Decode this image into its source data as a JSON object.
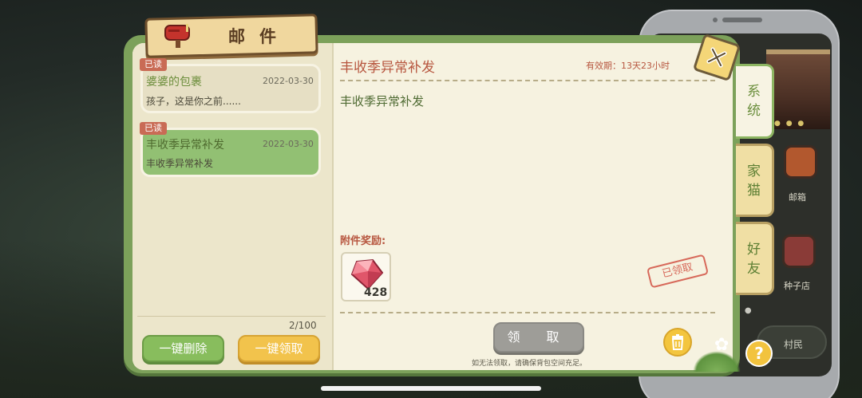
{
  "window": {
    "title": "邮件"
  },
  "mail_list": [
    {
      "badge": "已读",
      "title": "婆婆的包裹",
      "date": "2022-03-30",
      "preview": "孩子，这是你之前......",
      "state": "read"
    },
    {
      "badge": "已读",
      "title": "丰收季异常补发",
      "date": "2022-03-30",
      "preview": "丰收季异常补发",
      "state": "selected"
    }
  ],
  "mail_count": "2/100",
  "buttons": {
    "delete_all": "一键删除",
    "claim_all": "一键领取",
    "claim": "领 取"
  },
  "detail": {
    "subject": "丰收季异常补发",
    "validity": "有效期：13天23小时",
    "body": "丰收季异常补发",
    "attachment_label": "附件奖励:",
    "attachment": {
      "icon": "gem-icon",
      "count": "428"
    },
    "stamp": "已领取",
    "hint": "如无法领取，请确保背包空间充足。"
  },
  "tabs": [
    {
      "line1": "系",
      "line2": "统",
      "active": true
    },
    {
      "line1": "家",
      "line2": "猫",
      "active": false
    },
    {
      "line1": "好",
      "line2": "友",
      "active": false
    }
  ],
  "phone": {
    "apps": [
      {
        "label": "邮箱",
        "icon": "mailbox-icon"
      },
      {
        "label": "种子店",
        "icon": "shop-icon"
      }
    ],
    "villager_label": "村民"
  },
  "colors": {
    "frame_green": "#7ca15a",
    "paper": "#f6f2e0",
    "accent_red": "#b7563f",
    "selected_card": "#92c073",
    "claim_all_yellow": "#f2c34c",
    "disabled_gray": "#9e9d98"
  }
}
